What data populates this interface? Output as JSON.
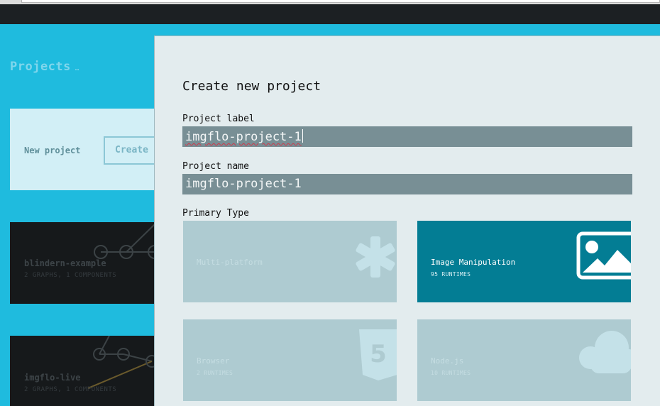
{
  "background": {
    "page_title": "Projects",
    "page_title_suffix": "…",
    "new_project_label": "New project",
    "create_button": "Create",
    "projects": [
      {
        "name": "blindern-example",
        "meta": "2 GRAPHS, 1 COMPONENTS"
      },
      {
        "name": "imgflo-live",
        "meta": "2 GRAPHS, 1 COMPONENTS"
      }
    ]
  },
  "dialog": {
    "title": "Create new project",
    "project_label": {
      "label": "Project label",
      "value": "imgflo-project-1"
    },
    "project_name": {
      "label": "Project name",
      "value": "imgflo-project-1"
    },
    "primary_type_label": "Primary Type",
    "types": [
      {
        "name": "Multi-platform",
        "meta": "",
        "icon": "asterisk-icon",
        "selected": false
      },
      {
        "name": "Image Manipulation",
        "meta": "95 RUNTIMES",
        "icon": "image-icon",
        "selected": true
      },
      {
        "name": "Browser",
        "meta": "2 RUNTIMES",
        "icon": "html5-icon",
        "selected": false
      },
      {
        "name": "Node.js",
        "meta": "10 RUNTIMES",
        "icon": "cloud-icon",
        "selected": false
      }
    ]
  },
  "colors": {
    "page_background": "#1fbbde",
    "modal_background": "#e3ecee",
    "input_background": "#788f95",
    "tile_background": "#aecbd1",
    "tile_selected": "#037d94"
  }
}
